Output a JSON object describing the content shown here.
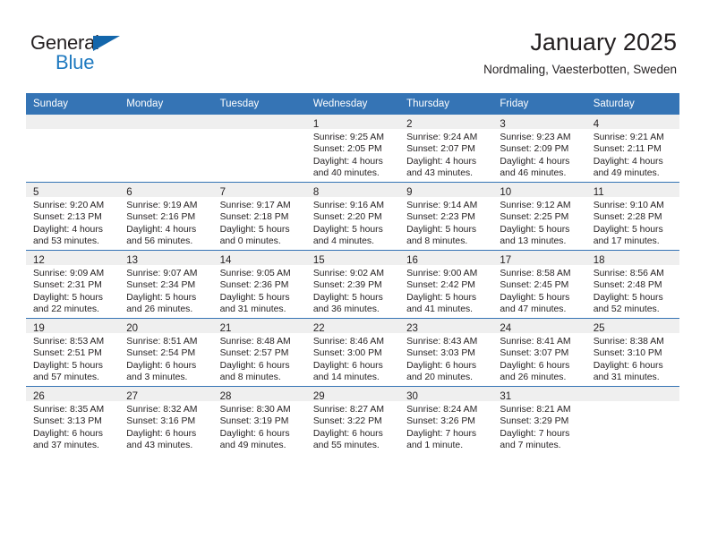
{
  "brand": {
    "name_part1": "General",
    "name_part2": "Blue",
    "logo_icon": "triangle-icon",
    "color_blue": "#1366ab",
    "color_text_blue": "#1f7ac0"
  },
  "header": {
    "title": "January 2025",
    "subtitle": "Nordmaling, Vaesterbotten, Sweden"
  },
  "theme": {
    "header_blue": "#3574b5",
    "daynum_band": "#efefef",
    "text": "#231f20"
  },
  "calendar": {
    "weekday_headers": [
      "Sunday",
      "Monday",
      "Tuesday",
      "Wednesday",
      "Thursday",
      "Friday",
      "Saturday"
    ],
    "weeks": [
      [
        {
          "empty": true,
          "day": "",
          "sunrise": "",
          "sunset": "",
          "daylight_line1": "",
          "daylight_line2": ""
        },
        {
          "empty": true,
          "day": "",
          "sunrise": "",
          "sunset": "",
          "daylight_line1": "",
          "daylight_line2": ""
        },
        {
          "empty": true,
          "day": "",
          "sunrise": "",
          "sunset": "",
          "daylight_line1": "",
          "daylight_line2": ""
        },
        {
          "empty": false,
          "day": "1",
          "sunrise": "Sunrise: 9:25 AM",
          "sunset": "Sunset: 2:05 PM",
          "daylight_line1": "Daylight: 4 hours",
          "daylight_line2": "and 40 minutes."
        },
        {
          "empty": false,
          "day": "2",
          "sunrise": "Sunrise: 9:24 AM",
          "sunset": "Sunset: 2:07 PM",
          "daylight_line1": "Daylight: 4 hours",
          "daylight_line2": "and 43 minutes."
        },
        {
          "empty": false,
          "day": "3",
          "sunrise": "Sunrise: 9:23 AM",
          "sunset": "Sunset: 2:09 PM",
          "daylight_line1": "Daylight: 4 hours",
          "daylight_line2": "and 46 minutes."
        },
        {
          "empty": false,
          "day": "4",
          "sunrise": "Sunrise: 9:21 AM",
          "sunset": "Sunset: 2:11 PM",
          "daylight_line1": "Daylight: 4 hours",
          "daylight_line2": "and 49 minutes."
        }
      ],
      [
        {
          "empty": false,
          "day": "5",
          "sunrise": "Sunrise: 9:20 AM",
          "sunset": "Sunset: 2:13 PM",
          "daylight_line1": "Daylight: 4 hours",
          "daylight_line2": "and 53 minutes."
        },
        {
          "empty": false,
          "day": "6",
          "sunrise": "Sunrise: 9:19 AM",
          "sunset": "Sunset: 2:16 PM",
          "daylight_line1": "Daylight: 4 hours",
          "daylight_line2": "and 56 minutes."
        },
        {
          "empty": false,
          "day": "7",
          "sunrise": "Sunrise: 9:17 AM",
          "sunset": "Sunset: 2:18 PM",
          "daylight_line1": "Daylight: 5 hours",
          "daylight_line2": "and 0 minutes."
        },
        {
          "empty": false,
          "day": "8",
          "sunrise": "Sunrise: 9:16 AM",
          "sunset": "Sunset: 2:20 PM",
          "daylight_line1": "Daylight: 5 hours",
          "daylight_line2": "and 4 minutes."
        },
        {
          "empty": false,
          "day": "9",
          "sunrise": "Sunrise: 9:14 AM",
          "sunset": "Sunset: 2:23 PM",
          "daylight_line1": "Daylight: 5 hours",
          "daylight_line2": "and 8 minutes."
        },
        {
          "empty": false,
          "day": "10",
          "sunrise": "Sunrise: 9:12 AM",
          "sunset": "Sunset: 2:25 PM",
          "daylight_line1": "Daylight: 5 hours",
          "daylight_line2": "and 13 minutes."
        },
        {
          "empty": false,
          "day": "11",
          "sunrise": "Sunrise: 9:10 AM",
          "sunset": "Sunset: 2:28 PM",
          "daylight_line1": "Daylight: 5 hours",
          "daylight_line2": "and 17 minutes."
        }
      ],
      [
        {
          "empty": false,
          "day": "12",
          "sunrise": "Sunrise: 9:09 AM",
          "sunset": "Sunset: 2:31 PM",
          "daylight_line1": "Daylight: 5 hours",
          "daylight_line2": "and 22 minutes."
        },
        {
          "empty": false,
          "day": "13",
          "sunrise": "Sunrise: 9:07 AM",
          "sunset": "Sunset: 2:34 PM",
          "daylight_line1": "Daylight: 5 hours",
          "daylight_line2": "and 26 minutes."
        },
        {
          "empty": false,
          "day": "14",
          "sunrise": "Sunrise: 9:05 AM",
          "sunset": "Sunset: 2:36 PM",
          "daylight_line1": "Daylight: 5 hours",
          "daylight_line2": "and 31 minutes."
        },
        {
          "empty": false,
          "day": "15",
          "sunrise": "Sunrise: 9:02 AM",
          "sunset": "Sunset: 2:39 PM",
          "daylight_line1": "Daylight: 5 hours",
          "daylight_line2": "and 36 minutes."
        },
        {
          "empty": false,
          "day": "16",
          "sunrise": "Sunrise: 9:00 AM",
          "sunset": "Sunset: 2:42 PM",
          "daylight_line1": "Daylight: 5 hours",
          "daylight_line2": "and 41 minutes."
        },
        {
          "empty": false,
          "day": "17",
          "sunrise": "Sunrise: 8:58 AM",
          "sunset": "Sunset: 2:45 PM",
          "daylight_line1": "Daylight: 5 hours",
          "daylight_line2": "and 47 minutes."
        },
        {
          "empty": false,
          "day": "18",
          "sunrise": "Sunrise: 8:56 AM",
          "sunset": "Sunset: 2:48 PM",
          "daylight_line1": "Daylight: 5 hours",
          "daylight_line2": "and 52 minutes."
        }
      ],
      [
        {
          "empty": false,
          "day": "19",
          "sunrise": "Sunrise: 8:53 AM",
          "sunset": "Sunset: 2:51 PM",
          "daylight_line1": "Daylight: 5 hours",
          "daylight_line2": "and 57 minutes."
        },
        {
          "empty": false,
          "day": "20",
          "sunrise": "Sunrise: 8:51 AM",
          "sunset": "Sunset: 2:54 PM",
          "daylight_line1": "Daylight: 6 hours",
          "daylight_line2": "and 3 minutes."
        },
        {
          "empty": false,
          "day": "21",
          "sunrise": "Sunrise: 8:48 AM",
          "sunset": "Sunset: 2:57 PM",
          "daylight_line1": "Daylight: 6 hours",
          "daylight_line2": "and 8 minutes."
        },
        {
          "empty": false,
          "day": "22",
          "sunrise": "Sunrise: 8:46 AM",
          "sunset": "Sunset: 3:00 PM",
          "daylight_line1": "Daylight: 6 hours",
          "daylight_line2": "and 14 minutes."
        },
        {
          "empty": false,
          "day": "23",
          "sunrise": "Sunrise: 8:43 AM",
          "sunset": "Sunset: 3:03 PM",
          "daylight_line1": "Daylight: 6 hours",
          "daylight_line2": "and 20 minutes."
        },
        {
          "empty": false,
          "day": "24",
          "sunrise": "Sunrise: 8:41 AM",
          "sunset": "Sunset: 3:07 PM",
          "daylight_line1": "Daylight: 6 hours",
          "daylight_line2": "and 26 minutes."
        },
        {
          "empty": false,
          "day": "25",
          "sunrise": "Sunrise: 8:38 AM",
          "sunset": "Sunset: 3:10 PM",
          "daylight_line1": "Daylight: 6 hours",
          "daylight_line2": "and 31 minutes."
        }
      ],
      [
        {
          "empty": false,
          "day": "26",
          "sunrise": "Sunrise: 8:35 AM",
          "sunset": "Sunset: 3:13 PM",
          "daylight_line1": "Daylight: 6 hours",
          "daylight_line2": "and 37 minutes."
        },
        {
          "empty": false,
          "day": "27",
          "sunrise": "Sunrise: 8:32 AM",
          "sunset": "Sunset: 3:16 PM",
          "daylight_line1": "Daylight: 6 hours",
          "daylight_line2": "and 43 minutes."
        },
        {
          "empty": false,
          "day": "28",
          "sunrise": "Sunrise: 8:30 AM",
          "sunset": "Sunset: 3:19 PM",
          "daylight_line1": "Daylight: 6 hours",
          "daylight_line2": "and 49 minutes."
        },
        {
          "empty": false,
          "day": "29",
          "sunrise": "Sunrise: 8:27 AM",
          "sunset": "Sunset: 3:22 PM",
          "daylight_line1": "Daylight: 6 hours",
          "daylight_line2": "and 55 minutes."
        },
        {
          "empty": false,
          "day": "30",
          "sunrise": "Sunrise: 8:24 AM",
          "sunset": "Sunset: 3:26 PM",
          "daylight_line1": "Daylight: 7 hours",
          "daylight_line2": "and 1 minute."
        },
        {
          "empty": false,
          "day": "31",
          "sunrise": "Sunrise: 8:21 AM",
          "sunset": "Sunset: 3:29 PM",
          "daylight_line1": "Daylight: 7 hours",
          "daylight_line2": "and 7 minutes."
        },
        {
          "empty": true,
          "day": "",
          "sunrise": "",
          "sunset": "",
          "daylight_line1": "",
          "daylight_line2": ""
        }
      ]
    ]
  }
}
